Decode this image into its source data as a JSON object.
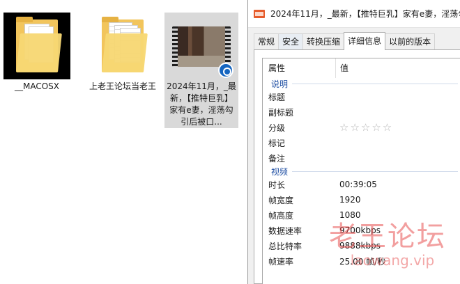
{
  "explorer": {
    "files": [
      {
        "name": "__MACOSX",
        "type": "folder"
      },
      {
        "name": "上老王论坛当老王",
        "type": "folder"
      },
      {
        "name": "2024年11月，_最新，【推特巨乳】家有e妻，淫荡勾引后被口...",
        "type": "video",
        "selected": true
      }
    ]
  },
  "dialog": {
    "title": "2024年11月，_最新，【推特巨乳】家有e妻，淫荡勾",
    "icon": "video-file-icon",
    "tabs": [
      "常规",
      "安全",
      "转换压缩",
      "详细信息",
      "以前的版本"
    ],
    "active_tab": "详细信息",
    "columns": {
      "name": "属性",
      "value": "值"
    },
    "groups": [
      {
        "label": "说明",
        "rows": [
          {
            "name": "标题",
            "value": ""
          },
          {
            "name": "副标题",
            "value": ""
          },
          {
            "name": "分级",
            "value": "☆☆☆☆☆"
          },
          {
            "name": "标记",
            "value": ""
          },
          {
            "name": "备注",
            "value": ""
          }
        ]
      },
      {
        "label": "视频",
        "rows": [
          {
            "name": "时长",
            "value": "00:39:05"
          },
          {
            "name": "帧宽度",
            "value": "1920"
          },
          {
            "name": "帧高度",
            "value": "1080"
          },
          {
            "name": "数据速率",
            "value": "9700kbps"
          },
          {
            "name": "总比特率",
            "value": "9888kbps"
          },
          {
            "name": "帧速率",
            "value": "25.00 帧/秒"
          }
        ]
      }
    ]
  },
  "watermark": {
    "text": "老王论坛",
    "url": "laowang.vip"
  },
  "colors": {
    "selection": "#d9d9d9",
    "group_label": "#1f4fa3",
    "watermark": "#e85050",
    "title_icon": "#e65b2b"
  }
}
